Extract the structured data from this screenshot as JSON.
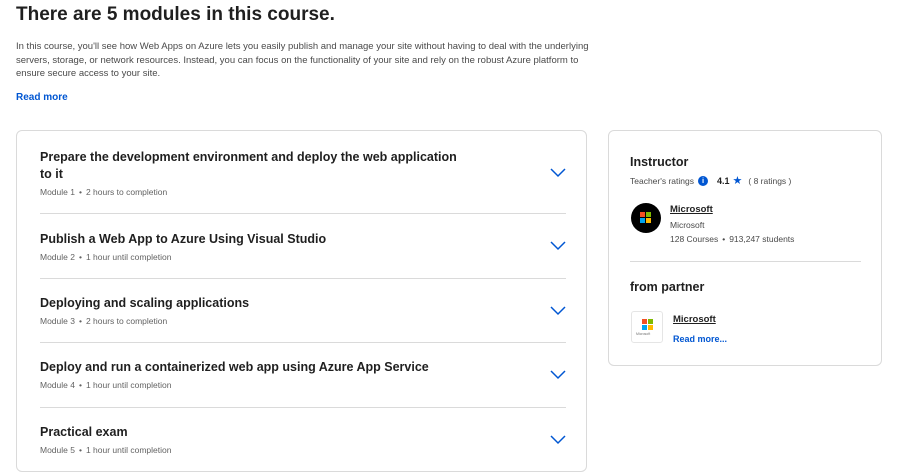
{
  "header": {
    "title": "There are 5 modules in this course.",
    "description": "In this course, you'll see how Web Apps on Azure lets you easily publish and manage your site without having to deal with the underlying servers, storage, or network resources. Instead, you can focus on the functionality of your site and rely on the robust Azure platform to ensure secure access to your site.",
    "read_more": "Read more"
  },
  "modules": [
    {
      "title": "Prepare the development environment and deploy the web application to it",
      "number": "Module 1",
      "duration": "2 hours to completion"
    },
    {
      "title": "Publish a Web App to Azure Using Visual Studio",
      "number": "Module 2",
      "duration": "1 hour until completion"
    },
    {
      "title": "Deploying and scaling applications",
      "number": "Module 3",
      "duration": "2 hours to completion"
    },
    {
      "title": "Deploy and run a containerized web app using Azure App Service",
      "number": "Module 4",
      "duration": "1 hour until completion"
    },
    {
      "title": "Practical exam",
      "number": "Module 5",
      "duration": "1 hour until completion"
    }
  ],
  "module_separator": "•",
  "instructor": {
    "heading": "Instructor",
    "ratings_label": "Teacher's ratings",
    "rating": "4.1",
    "rating_count": "( 8 ratings )",
    "name": "Microsoft",
    "org": "Microsoft",
    "courses": "128 Courses",
    "students": "913,247 students",
    "separator": "•"
  },
  "partner": {
    "heading": "from partner",
    "name": "Microsoft",
    "logo_text": "Microsoft",
    "read_more": "Read more..."
  },
  "icons": {
    "chevron": "chevron-down-icon",
    "info": "info-icon",
    "star": "star-icon",
    "logo": "microsoft-logo-icon"
  },
  "colors": {
    "accent": "#0056d2",
    "ms_red": "#f25022",
    "ms_green": "#7fba00",
    "ms_blue": "#00a4ef",
    "ms_yellow": "#ffb900"
  }
}
